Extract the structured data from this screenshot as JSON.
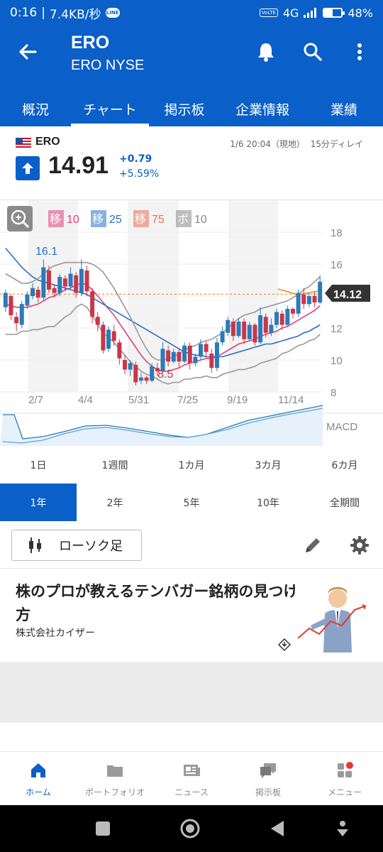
{
  "status_bar": {
    "time": "0:16",
    "speed": "7.4KB/秒",
    "line_badge": "LINE",
    "volte": "VoLTE",
    "network": "4G",
    "battery_pct": "48%",
    "battery_level": 0.48
  },
  "header": {
    "title": "ERO",
    "subtitle": "ERO NYSE"
  },
  "tabs": [
    {
      "label": "概況",
      "active": false
    },
    {
      "label": "チャート",
      "active": true
    },
    {
      "label": "掲示板",
      "active": false
    },
    {
      "label": "企業情報",
      "active": false
    },
    {
      "label": "業績",
      "active": false
    }
  ],
  "quote": {
    "symbol": "ERO",
    "datetime": "1/6 20:04（現地）",
    "delay": "15分ディレイ",
    "price": "14.91",
    "change": "+0.79",
    "change_pct": "+5.59%",
    "up_color": "#0a5fc9"
  },
  "chart": {
    "legend": [
      {
        "tag": "移",
        "value": "10",
        "color": "#e0407a"
      },
      {
        "tag": "移",
        "value": "25",
        "color": "#2a6fc9"
      },
      {
        "tag": "移",
        "value": "75",
        "color": "#e86f5a"
      },
      {
        "tag": "ボ",
        "value": "10",
        "color": "#888888"
      }
    ],
    "current_label": "14.12",
    "high_label": "16.1",
    "low_label": "8.5",
    "macd_label": "MACD"
  },
  "chart_data": {
    "type": "candlestick",
    "x_ticks": [
      "2/7",
      "4/4",
      "5/31",
      "7/25",
      "9/19",
      "11/14"
    ],
    "y_ticks": [
      "18",
      "16",
      "14",
      "12",
      "10",
      "8"
    ],
    "ylim": [
      8,
      18
    ],
    "current_price": 14.12,
    "annotated_high": 16.1,
    "annotated_low": 8.5,
    "candles": [
      [
        13.3,
        14.2,
        13.0,
        14.4
      ],
      [
        14.0,
        12.8,
        12.5,
        14.1
      ],
      [
        12.7,
        12.3,
        11.8,
        13.0
      ],
      [
        12.2,
        13.5,
        12.0,
        13.7
      ],
      [
        13.4,
        14.1,
        13.2,
        14.3
      ],
      [
        14.0,
        14.5,
        13.8,
        14.8
      ],
      [
        14.4,
        13.9,
        13.6,
        14.6
      ],
      [
        13.9,
        15.8,
        13.7,
        16.3
      ],
      [
        15.6,
        14.4,
        14.2,
        15.9
      ],
      [
        14.5,
        14.2,
        13.9,
        14.7
      ],
      [
        14.2,
        15.2,
        14.0,
        15.4
      ],
      [
        15.1,
        14.6,
        14.3,
        15.3
      ],
      [
        14.6,
        15.4,
        14.5,
        15.8
      ],
      [
        15.3,
        14.2,
        13.9,
        15.5
      ],
      [
        14.2,
        15.7,
        14.0,
        16.3
      ],
      [
        15.6,
        14.3,
        14.0,
        15.9
      ],
      [
        14.3,
        12.7,
        12.3,
        14.5
      ],
      [
        12.7,
        12.2,
        11.8,
        13.0
      ],
      [
        12.2,
        10.6,
        10.4,
        12.4
      ],
      [
        10.7,
        11.9,
        10.5,
        12.1
      ],
      [
        11.8,
        11.2,
        10.9,
        12.2
      ],
      [
        11.1,
        10.1,
        9.7,
        11.3
      ],
      [
        10.0,
        9.4,
        9.1,
        10.3
      ],
      [
        9.4,
        9.8,
        9.0,
        10.0
      ],
      [
        9.7,
        8.6,
        8.4,
        9.9
      ],
      [
        8.7,
        8.9,
        8.5,
        9.2
      ],
      [
        8.9,
        8.7,
        8.5,
        9.0
      ],
      [
        8.7,
        9.6,
        8.6,
        9.8
      ],
      [
        9.5,
        9.3,
        9.0,
        9.8
      ],
      [
        9.3,
        10.7,
        9.2,
        11.1
      ],
      [
        10.6,
        9.9,
        9.6,
        10.9
      ],
      [
        9.9,
        10.5,
        9.8,
        10.7
      ],
      [
        10.5,
        9.9,
        9.5,
        10.7
      ],
      [
        9.9,
        10.9,
        9.8,
        11.1
      ],
      [
        10.9,
        9.8,
        9.4,
        11.1
      ],
      [
        9.8,
        10.2,
        9.6,
        10.4
      ],
      [
        10.2,
        11.0,
        10.0,
        11.3
      ],
      [
        11.0,
        10.5,
        10.2,
        11.2
      ],
      [
        10.4,
        9.5,
        9.2,
        10.7
      ],
      [
        9.5,
        11.1,
        9.3,
        11.4
      ],
      [
        11.1,
        11.8,
        10.9,
        12.1
      ],
      [
        11.7,
        12.5,
        11.5,
        12.7
      ],
      [
        12.4,
        11.5,
        11.2,
        12.6
      ],
      [
        11.5,
        12.4,
        11.4,
        12.6
      ],
      [
        12.4,
        11.3,
        11.0,
        12.6
      ],
      [
        11.3,
        12.2,
        11.2,
        12.4
      ],
      [
        12.2,
        11.1,
        10.9,
        12.3
      ],
      [
        11.1,
        12.8,
        11.0,
        13.3
      ],
      [
        12.7,
        11.7,
        11.4,
        12.9
      ],
      [
        11.7,
        12.2,
        11.5,
        12.6
      ],
      [
        12.2,
        13.0,
        12.0,
        13.2
      ],
      [
        12.9,
        12.2,
        11.9,
        13.1
      ],
      [
        12.2,
        13.2,
        12.1,
        13.4
      ],
      [
        13.2,
        12.9,
        12.6,
        13.3
      ],
      [
        12.9,
        14.2,
        12.7,
        14.4
      ],
      [
        14.1,
        13.5,
        13.2,
        14.5
      ],
      [
        13.5,
        14.0,
        13.3,
        14.2
      ],
      [
        14.0,
        13.6,
        13.3,
        14.3
      ],
      [
        13.6,
        14.9,
        13.5,
        15.3
      ]
    ],
    "series": [
      {
        "name": "移 10",
        "color": "#e0407a",
        "values": [
          13.5,
          13.4,
          13.3,
          13.3,
          13.3,
          13.4,
          13.5,
          13.7,
          13.9,
          14.0,
          14.2,
          14.4,
          14.5,
          14.7,
          14.8,
          14.7,
          14.4,
          14.0,
          13.6,
          13.2,
          12.8,
          12.3,
          11.8,
          11.3,
          10.8,
          10.3,
          9.9,
          9.6,
          9.4,
          9.3,
          9.3,
          9.4,
          9.5,
          9.7,
          9.8,
          9.9,
          10.0,
          10.1,
          10.1,
          10.2,
          10.4,
          10.6,
          10.8,
          11.0,
          11.1,
          11.2,
          11.3,
          11.5,
          11.6,
          11.7,
          11.8,
          12.0,
          12.1,
          12.3,
          12.5,
          12.7,
          12.9,
          13.1,
          13.4
        ]
      },
      {
        "name": "移 25",
        "color": "#2a6fc9",
        "values": [
          17.0,
          16.6,
          16.2,
          15.8,
          15.5,
          15.2,
          15.0,
          14.9,
          14.8,
          14.7,
          14.6,
          14.5,
          14.4,
          14.3,
          14.2,
          14.1,
          13.9,
          13.7,
          13.5,
          13.3,
          13.1,
          12.9,
          12.7,
          12.5,
          12.3,
          12.1,
          11.9,
          11.7,
          11.5,
          11.3,
          11.1,
          10.9,
          10.7,
          10.5,
          10.4,
          10.3,
          10.3,
          10.2,
          10.2,
          10.2,
          10.2,
          10.3,
          10.4,
          10.5,
          10.6,
          10.7,
          10.8,
          10.9,
          11.0,
          11.0,
          11.1,
          11.2,
          11.3,
          11.4,
          11.5,
          11.7,
          11.8,
          12.0,
          12.2
        ]
      },
      {
        "name": "ボ upper",
        "color": "#999999",
        "values": [
          15.4,
          15.2,
          15.0,
          14.8,
          14.8,
          14.9,
          15.1,
          15.4,
          15.7,
          15.9,
          16.0,
          16.1,
          16.1,
          16.1,
          16.1,
          16.1,
          16.0,
          15.8,
          15.5,
          15.0,
          14.5,
          13.9,
          13.3,
          12.7,
          12.0,
          11.3,
          10.7,
          10.2,
          10.0,
          10.0,
          10.1,
          10.2,
          10.4,
          10.6,
          10.8,
          10.9,
          11.1,
          11.2,
          11.3,
          11.5,
          11.7,
          12.0,
          12.3,
          12.6,
          12.8,
          12.9,
          13.0,
          13.2,
          13.3,
          13.4,
          13.5,
          13.6,
          13.7,
          13.9,
          14.1,
          14.4,
          14.6,
          14.9,
          15.2
        ]
      },
      {
        "name": "ボ lower",
        "color": "#999999",
        "values": [
          11.6,
          11.6,
          11.6,
          11.8,
          11.8,
          11.9,
          11.9,
          12.0,
          12.1,
          12.1,
          12.4,
          12.7,
          12.9,
          13.3,
          13.5,
          13.3,
          12.8,
          12.2,
          11.7,
          11.4,
          11.1,
          10.7,
          10.3,
          9.9,
          9.6,
          9.3,
          9.1,
          9.0,
          8.8,
          8.6,
          8.5,
          8.6,
          8.6,
          8.8,
          8.8,
          8.9,
          8.9,
          9.0,
          8.9,
          8.9,
          9.1,
          9.2,
          9.3,
          9.4,
          9.4,
          9.5,
          9.6,
          9.8,
          9.9,
          10.0,
          10.1,
          10.4,
          10.5,
          10.7,
          10.9,
          11.0,
          11.2,
          11.3,
          11.6
        ]
      }
    ]
  },
  "ranges": {
    "row1": [
      "1日",
      "1週間",
      "1カ月",
      "3カ月",
      "6カ月"
    ],
    "row2": [
      "1年",
      "2年",
      "5年",
      "10年",
      "全期間"
    ],
    "active": "1年"
  },
  "tools": {
    "candle_label": "ローソク足"
  },
  "ad": {
    "title": "株のプロが教えるテンバガー銘柄の見つけ方",
    "sponsor": "株式会社カイザー"
  },
  "bottom_nav": [
    {
      "label": "ホーム",
      "icon": "home-icon",
      "active": true
    },
    {
      "label": "ポートフォリオ",
      "icon": "folder-icon",
      "active": false
    },
    {
      "label": "ニュース",
      "icon": "news-icon",
      "active": false
    },
    {
      "label": "掲示板",
      "icon": "chat-icon",
      "active": false
    },
    {
      "label": "メニュー",
      "icon": "menu-grid-icon",
      "active": false
    }
  ]
}
